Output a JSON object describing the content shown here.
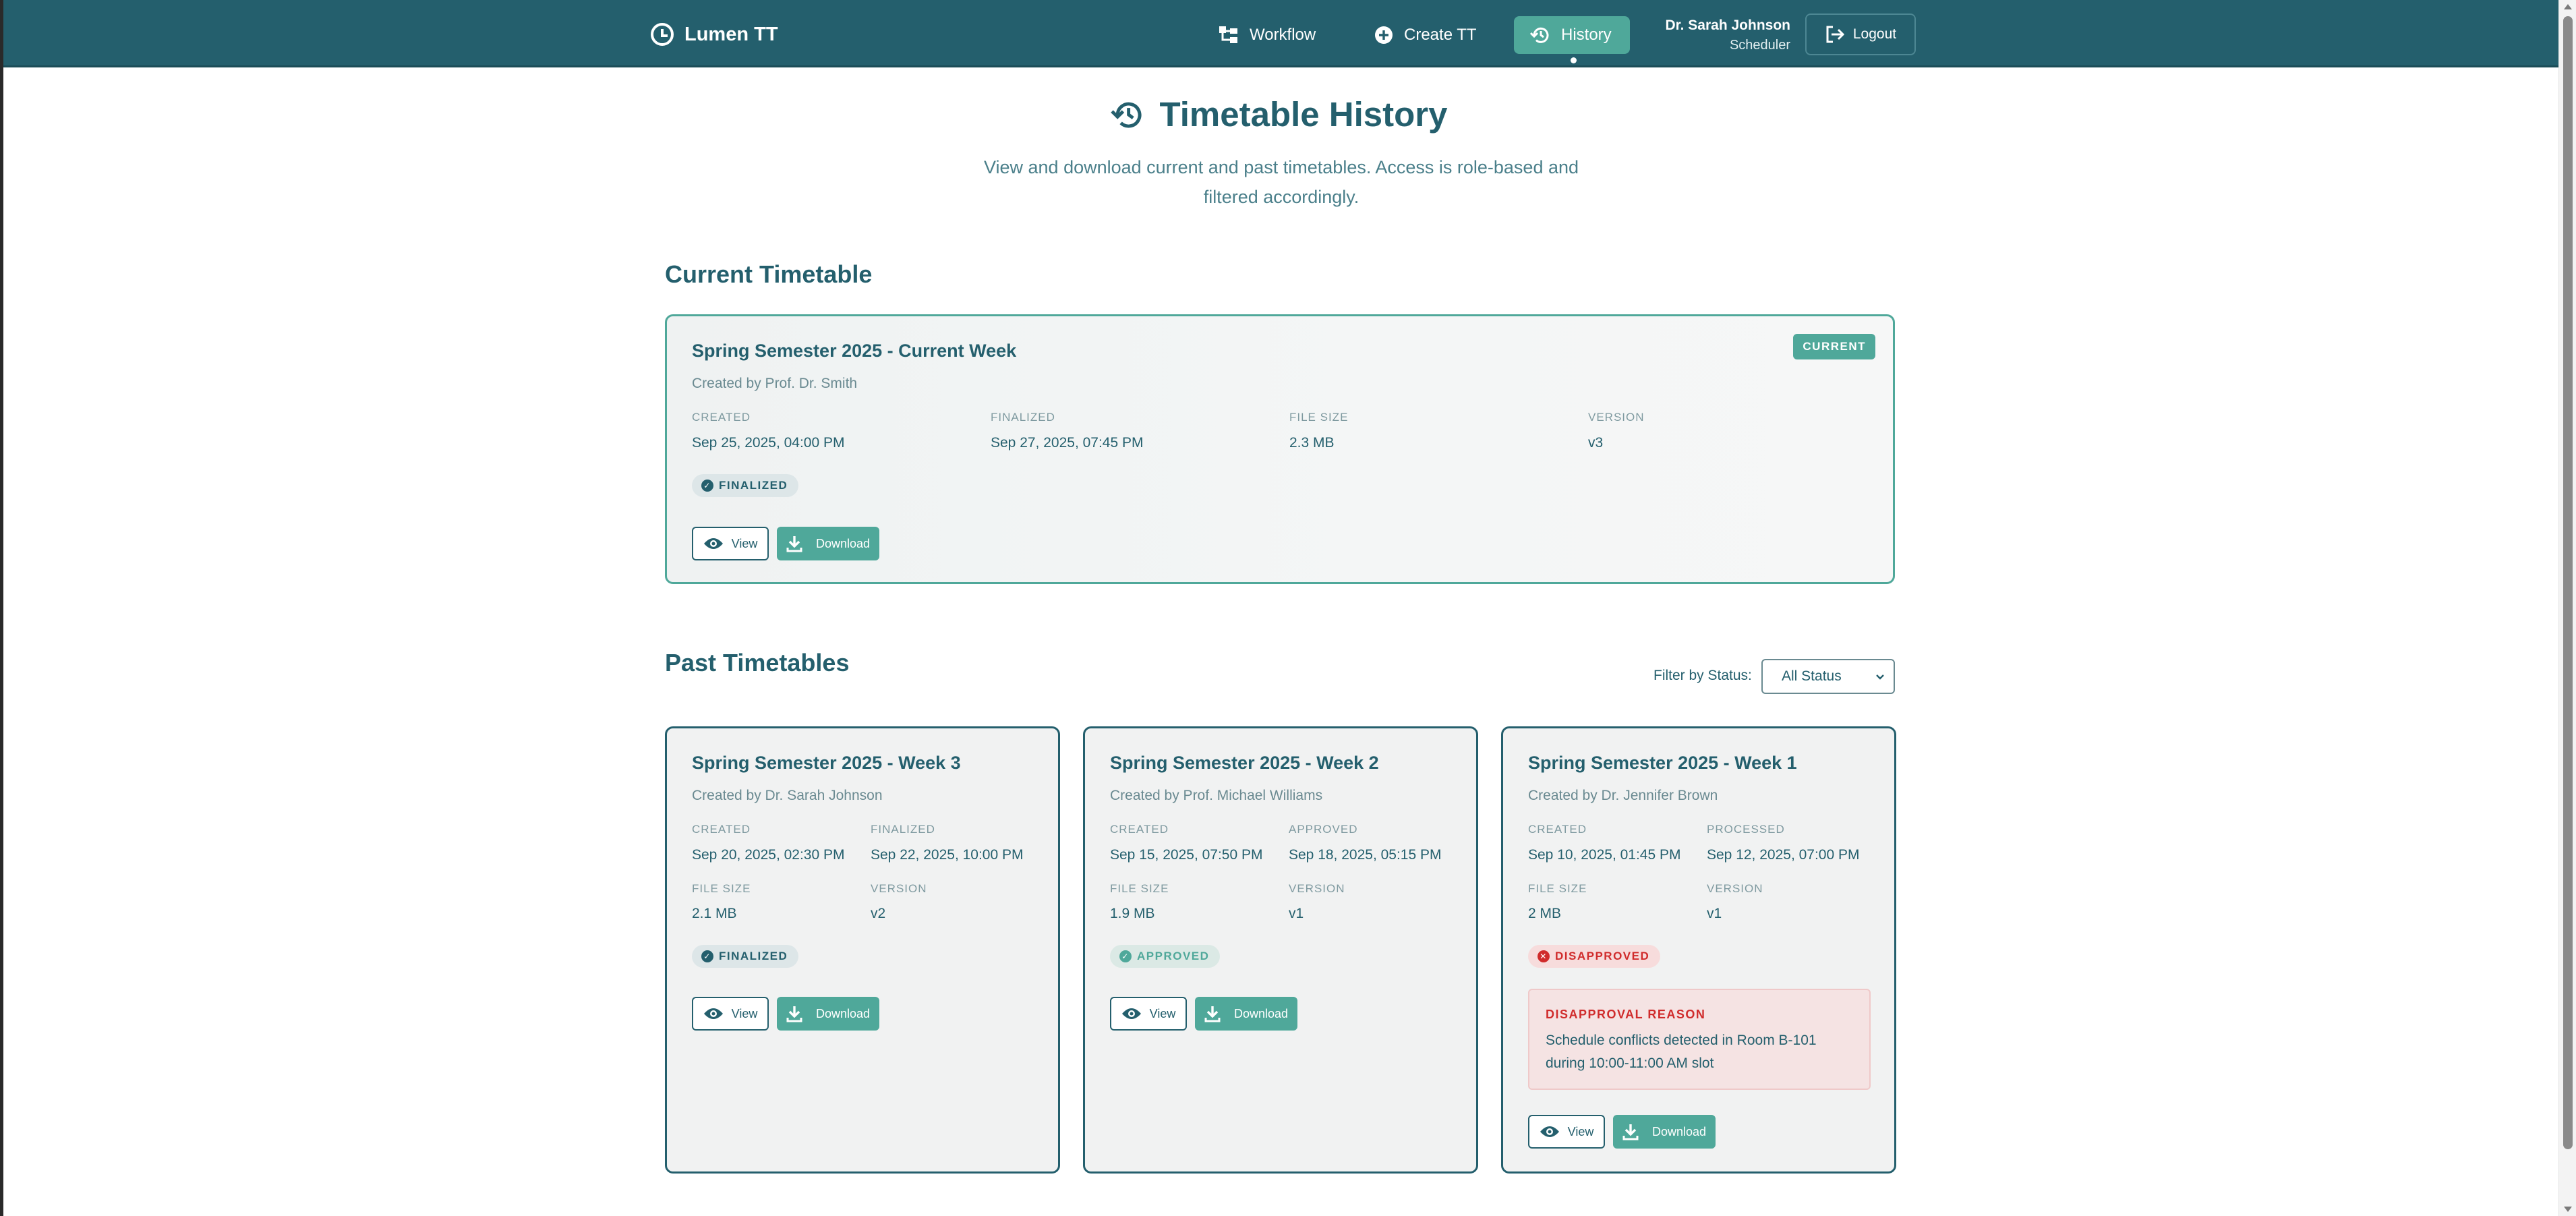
{
  "nav": {
    "brand": "Lumen TT",
    "links": [
      {
        "label": "Workflow"
      },
      {
        "label": "Create TT"
      },
      {
        "label": "History"
      }
    ],
    "user_name": "Dr. Sarah Johnson",
    "user_role": "Scheduler",
    "logout_label": "Logout"
  },
  "header": {
    "title": "Timetable History",
    "subtitle": "View and download current and past timetables. Access is role-based and filtered accordingly."
  },
  "current_section": {
    "title": "Current Timetable",
    "card": {
      "tag": "CURRENT",
      "title": "Spring Semester 2025 - Current Week",
      "creator": "Created by Prof. Dr. Smith",
      "meta": [
        {
          "label": "CREATED",
          "value": "Sep 25, 2025, 04:00 PM"
        },
        {
          "label": "FINALIZED",
          "value": "Sep 27, 2025, 07:45 PM"
        },
        {
          "label": "FILE SIZE",
          "value": "2.3 MB"
        },
        {
          "label": "VERSION",
          "value": "v3"
        }
      ],
      "status": "FINALIZED",
      "view_label": "View",
      "download_label": "Download"
    }
  },
  "past_section": {
    "title": "Past Timetables",
    "filter_label": "Filter by Status:",
    "filter_value": "All Status",
    "cards": [
      {
        "title": "Spring Semester 2025 - Week 3",
        "creator": "Created by Dr. Sarah Johnson",
        "meta": [
          {
            "label": "CREATED",
            "value": "Sep 20, 2025, 02:30 PM"
          },
          {
            "label": "FINALIZED",
            "value": "Sep 22, 2025, 10:00 PM"
          },
          {
            "label": "FILE SIZE",
            "value": "2.1 MB"
          },
          {
            "label": "VERSION",
            "value": "v2"
          }
        ],
        "status": "FINALIZED",
        "view_label": "View",
        "download_label": "Download"
      },
      {
        "title": "Spring Semester 2025 - Week 2",
        "creator": "Created by Prof. Michael Williams",
        "meta": [
          {
            "label": "CREATED",
            "value": "Sep 15, 2025, 07:50 PM"
          },
          {
            "label": "APPROVED",
            "value": "Sep 18, 2025, 05:15 PM"
          },
          {
            "label": "FILE SIZE",
            "value": "1.9 MB"
          },
          {
            "label": "VERSION",
            "value": "v1"
          }
        ],
        "status": "APPROVED",
        "view_label": "View",
        "download_label": "Download"
      },
      {
        "title": "Spring Semester 2025 - Week 1",
        "creator": "Created by Dr. Jennifer Brown",
        "meta": [
          {
            "label": "CREATED",
            "value": "Sep 10, 2025, 01:45 PM"
          },
          {
            "label": "PROCESSED",
            "value": "Sep 12, 2025, 07:00 PM"
          },
          {
            "label": "FILE SIZE",
            "value": "2 MB"
          },
          {
            "label": "VERSION",
            "value": "v1"
          }
        ],
        "status": "DISAPPROVED",
        "reason_title": "DISAPPROVAL REASON",
        "reason_text": "Schedule conflicts detected in Room B-101 during 10:00-11:00 AM slot",
        "view_label": "View",
        "download_label": "Download"
      }
    ]
  },
  "colors": {
    "primary": "#245f6d",
    "accent": "#4fa89a",
    "danger": "#d02b2b"
  }
}
